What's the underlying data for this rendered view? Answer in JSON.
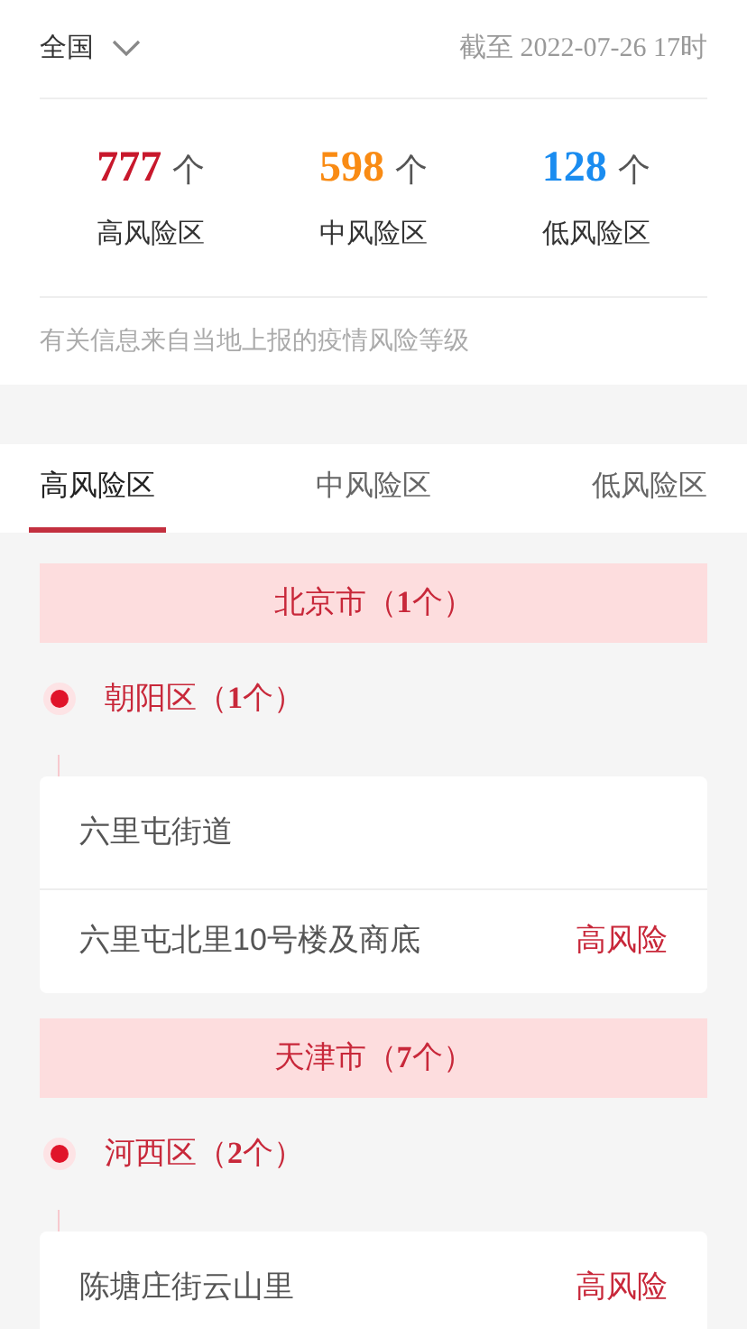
{
  "region_selector": {
    "label": "全国"
  },
  "updated": "截至 2022-07-26 17时",
  "stats": [
    {
      "count": "777",
      "unit": "个",
      "label": "高风险区",
      "color": "#c8182c"
    },
    {
      "count": "598",
      "unit": "个",
      "label": "中风险区",
      "color": "#f98b14"
    },
    {
      "count": "128",
      "unit": "个",
      "label": "低风险区",
      "color": "#1a8cf0"
    }
  ],
  "note": "有关信息来自当地上报的疫情风险等级",
  "tabs": [
    {
      "label": "高风险区",
      "selected": true
    },
    {
      "label": "中风险区",
      "selected": false
    },
    {
      "label": "低风险区",
      "selected": false
    }
  ],
  "cities": [
    {
      "title": "北京市（**1**个）",
      "districts": [
        {
          "title": "朝阳区（**1**个）",
          "groups": [
            [
              {
                "name": "六里屯街道"
              },
              {
                "name": "六里屯北里10号楼及商底",
                "risk": "高风险"
              }
            ]
          ]
        }
      ]
    },
    {
      "title": "天津市（**7**个）",
      "districts": [
        {
          "title": "河西区（**2**个）",
          "groups": [
            [
              {
                "name": "陈塘庄街云山里",
                "risk": "高风险"
              }
            ]
          ]
        }
      ]
    }
  ]
}
